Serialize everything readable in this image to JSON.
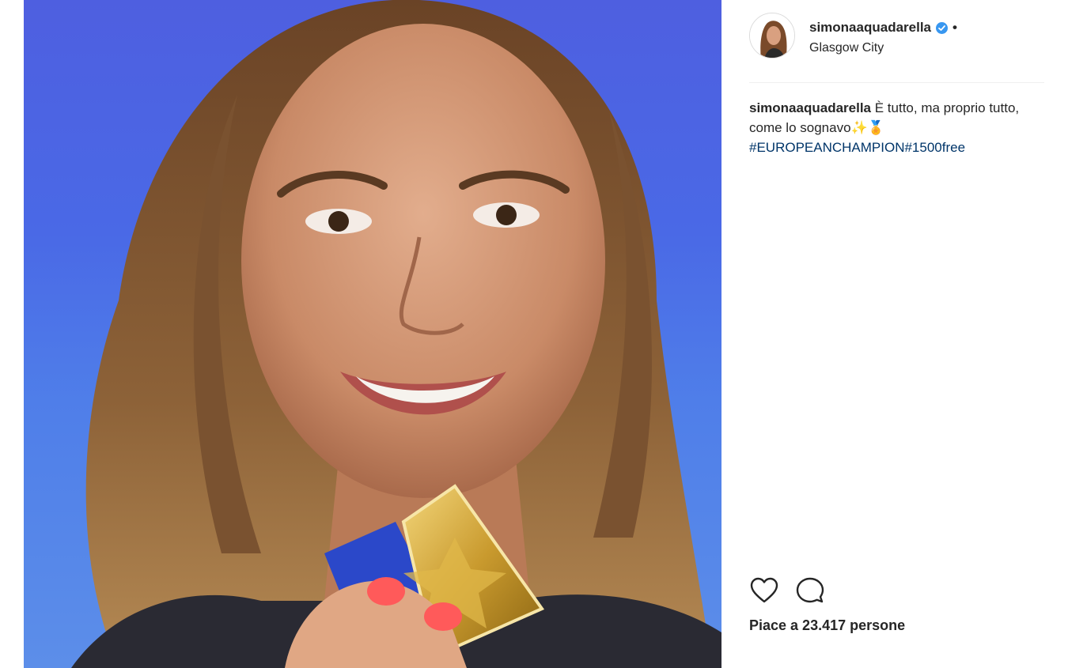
{
  "post": {
    "username": "simonaaquadarella",
    "separator_dot": "•",
    "location": "Glasgow City",
    "caption_username": "simonaaquadarella",
    "caption_text": "È tutto, ma proprio tutto, come lo sognavo✨🏅",
    "hashtags": "#EUROPEANCHAMPION#1500free",
    "likes_text": "Piace a 23.417 persone"
  },
  "icons": {
    "verified": "verified-badge-icon",
    "like": "heart-icon",
    "comment": "comment-bubble-icon"
  },
  "colors": {
    "photo_background": "#4f6ee6",
    "hashtag": "#003569",
    "verified": "#3897f0"
  }
}
